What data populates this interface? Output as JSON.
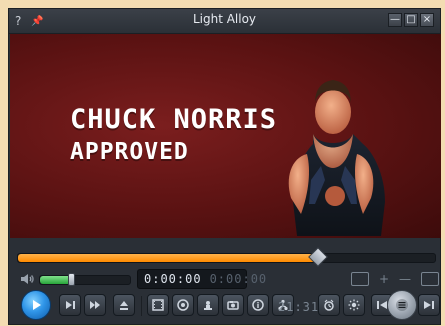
{
  "window": {
    "title": "Light Alloy",
    "help_label": "?",
    "pin_label": "📌",
    "buttons": {
      "minimize": "—",
      "maximize": "□",
      "close": "×"
    }
  },
  "video": {
    "caption_line1": "CHUCK NORRIS",
    "caption_line2": "APPROVED"
  },
  "playback": {
    "progress": 0.72,
    "volume": 0.34,
    "time_current": "0:00:00",
    "time_remaining": "0:00:00",
    "clock": "21:31"
  },
  "icons": {
    "help": "question-mark-icon",
    "pin": "pin-icon",
    "volume": "speaker-icon",
    "play": "play-icon",
    "next_frame": "next-frame-icon",
    "fast_forward": "fast-forward-icon",
    "eject": "eject-icon",
    "film": "film-icon",
    "audio": "audio-icon",
    "stamp": "stamp-icon",
    "camera": "camera-icon",
    "info": "info-icon",
    "tree": "tree-icon",
    "alarm": "alarm-clock-icon",
    "settings": "settings-icon",
    "prev": "previous-icon",
    "menu": "menu-icon",
    "next": "next-icon",
    "screen": "screen-icon"
  },
  "colors": {
    "accent_orange": "#ff8b00",
    "accent_blue": "#2f95e8",
    "video_red": "#6a1616",
    "volume_green": "#27a53a"
  }
}
